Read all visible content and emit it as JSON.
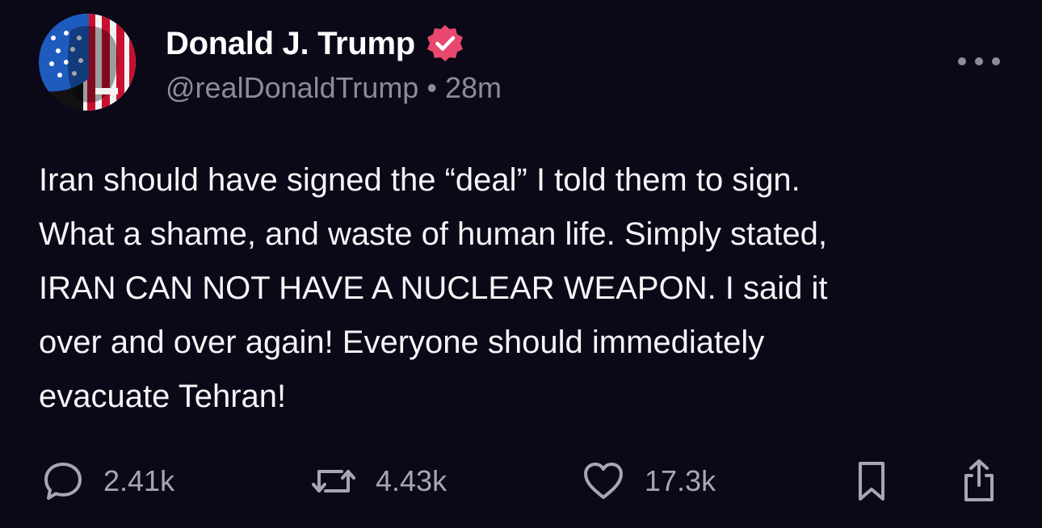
{
  "author": {
    "display_name": "Donald J. Trump",
    "handle": "@realDonaldTrump",
    "separator": "•",
    "timestamp": "28m",
    "verified": true,
    "verified_badge_color": "#e8486e",
    "avatar_description_icon": "flag-portrait-avatar"
  },
  "post": {
    "text": "Iran should have signed the “deal” I told them to sign.\nWhat a shame, and waste of human life. Simply stated,\nIRAN CAN NOT HAVE A NUCLEAR WEAPON. I said it\nover and over again! Everyone should immediately\nevacuate Tehran!"
  },
  "actions": {
    "replies": "2.41k",
    "reposts": "4.43k",
    "likes": "17.3k"
  },
  "colors": {
    "background": "#0b0818",
    "primary_text": "#f5f5f7",
    "secondary_text": "#8e8b99",
    "accent": "#e8486e"
  },
  "icons": {
    "more": "more-horizontal-icon",
    "reply": "speech-bubble-icon",
    "repost": "repost-arrows-icon",
    "like": "heart-icon",
    "bookmark": "bookmark-icon",
    "share": "share-icon"
  }
}
